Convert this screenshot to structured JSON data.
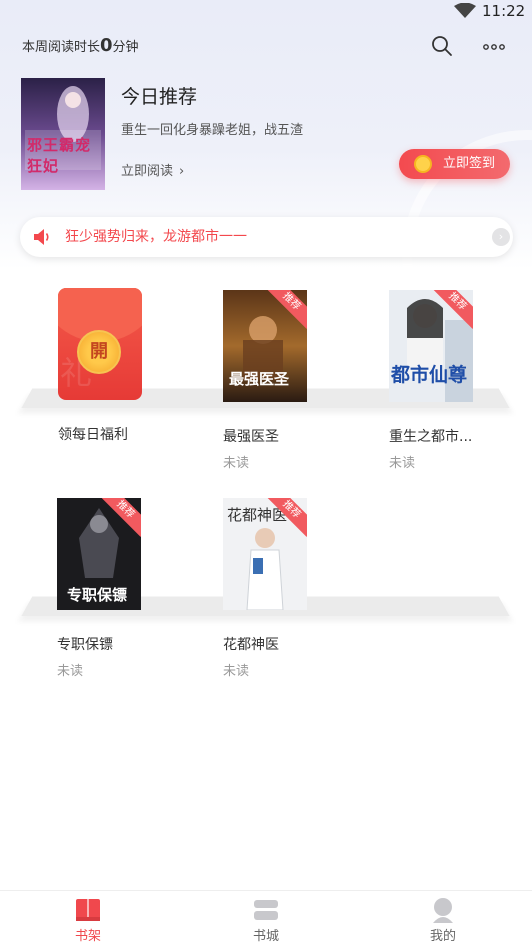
{
  "status_bar": {
    "time": "11:22"
  },
  "header": {
    "reading_prefix": "本周阅读时长",
    "reading_minutes": "0",
    "reading_unit": "分钟",
    "search_icon": "search-icon",
    "more_icon": "more-icon"
  },
  "recommend": {
    "title": "今日推荐",
    "description": "重生一回化身暴躁老姐，战五渣",
    "read_label": "立即阅读",
    "read_chevron": "›",
    "cover_title": "邪王霸宠狂妃",
    "signin_label": "立即签到"
  },
  "notice": {
    "text": "狂少强势归来，龙游都市一一",
    "arrow": "›"
  },
  "shelf": {
    "welfare": {
      "name": "领每日福利",
      "seal_char": "開"
    },
    "books": [
      {
        "name": "最强医圣",
        "status": "未读",
        "badge": "推荐",
        "cover_title": "最强医圣"
      },
      {
        "name": "重生之都市...",
        "status": "未读",
        "badge": "推荐",
        "cover_title": "都市仙尊"
      },
      {
        "name": "专职保镖",
        "status": "未读",
        "badge": "推荐",
        "cover_title": "专职保镖"
      },
      {
        "name": "花都神医",
        "status": "未读",
        "badge": "推荐",
        "cover_title": "花都神医"
      }
    ]
  },
  "tabbar": {
    "tabs": [
      {
        "label": "书架",
        "active": true
      },
      {
        "label": "书城",
        "active": false
      },
      {
        "label": "我的",
        "active": false
      }
    ]
  },
  "colors": {
    "accent": "#f0484d",
    "notice_text": "#f3484d",
    "muted": "#999999"
  }
}
